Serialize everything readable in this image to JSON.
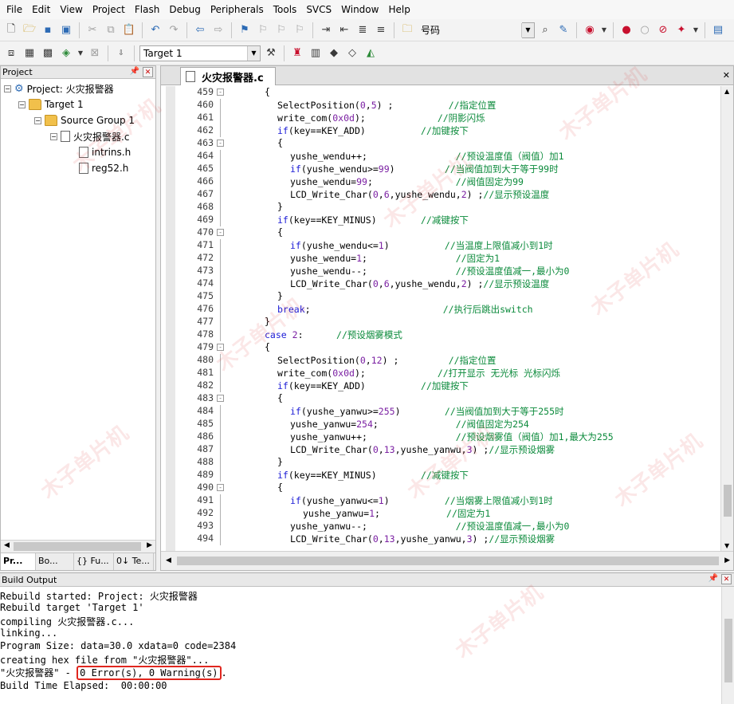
{
  "menu": [
    "File",
    "Edit",
    "View",
    "Project",
    "Flash",
    "Debug",
    "Peripherals",
    "Tools",
    "SVCS",
    "Window",
    "Help"
  ],
  "toolbar": {
    "find_text": "号码",
    "target_select": "Target 1"
  },
  "project_panel": {
    "title": "Project",
    "tree": {
      "project": "Project: 火灾报警器",
      "target": "Target 1",
      "group": "Source Group 1",
      "file": "火灾报警器.c",
      "includes": [
        "intrins.h",
        "reg52.h"
      ]
    },
    "tabs": [
      "Pr...",
      "Bo...",
      "{} Fu...",
      "0↓ Te..."
    ]
  },
  "editor": {
    "tab_label": "火灾报警器.c",
    "lines": [
      {
        "n": "459",
        "fold": "-",
        "indent": 0,
        "parts": [
          [
            "t",
            "{"
          ]
        ]
      },
      {
        "n": "460",
        "fold": "",
        "indent": 1,
        "parts": [
          [
            "t",
            "SelectPosition("
          ],
          [
            "num",
            "0"
          ],
          [
            "t",
            ","
          ],
          [
            "num",
            "5"
          ],
          [
            "t",
            ") ;          "
          ],
          [
            "cm",
            "//指定位置"
          ]
        ]
      },
      {
        "n": "461",
        "fold": "",
        "indent": 1,
        "parts": [
          [
            "t",
            "write_com("
          ],
          [
            "num",
            "0x0d"
          ],
          [
            "t",
            ");             "
          ],
          [
            "cm",
            "//阴影闪烁"
          ]
        ]
      },
      {
        "n": "462",
        "fold": "",
        "indent": 1,
        "parts": [
          [
            "kw",
            "if"
          ],
          [
            "t",
            "(key==KEY_ADD)          "
          ],
          [
            "cm",
            "//加键按下"
          ]
        ]
      },
      {
        "n": "463",
        "fold": "-",
        "indent": 1,
        "parts": [
          [
            "t",
            "{"
          ]
        ]
      },
      {
        "n": "464",
        "fold": "",
        "indent": 2,
        "parts": [
          [
            "t",
            "yushe_wendu++;                "
          ],
          [
            "cm",
            "//预设温度值（阀值）加1"
          ]
        ]
      },
      {
        "n": "465",
        "fold": "",
        "indent": 2,
        "parts": [
          [
            "kw",
            "if"
          ],
          [
            "t",
            "(yushe_wendu>="
          ],
          [
            "num",
            "99"
          ],
          [
            "t",
            ")         "
          ],
          [
            "cm",
            "//当阀值加到大于等于99时"
          ]
        ]
      },
      {
        "n": "466",
        "fold": "",
        "indent": 2,
        "parts": [
          [
            "t",
            "yushe_wendu="
          ],
          [
            "num",
            "99"
          ],
          [
            "t",
            ";               "
          ],
          [
            "cm",
            "//阀值固定为99"
          ]
        ]
      },
      {
        "n": "467",
        "fold": "",
        "indent": 2,
        "parts": [
          [
            "t",
            "LCD_Write_Char("
          ],
          [
            "num",
            "0"
          ],
          [
            "t",
            ","
          ],
          [
            "num",
            "6"
          ],
          [
            "t",
            ",yushe_wendu,"
          ],
          [
            "num",
            "2"
          ],
          [
            "t",
            ") ;"
          ],
          [
            "cm",
            "//显示预设温度"
          ]
        ]
      },
      {
        "n": "468",
        "fold": "",
        "indent": 1,
        "parts": [
          [
            "t",
            "}"
          ]
        ]
      },
      {
        "n": "469",
        "fold": "",
        "indent": 1,
        "parts": [
          [
            "kw",
            "if"
          ],
          [
            "t",
            "(key==KEY_MINUS)        "
          ],
          [
            "cm",
            "//减键按下"
          ]
        ]
      },
      {
        "n": "470",
        "fold": "-",
        "indent": 1,
        "parts": [
          [
            "t",
            "{"
          ]
        ]
      },
      {
        "n": "471",
        "fold": "",
        "indent": 2,
        "parts": [
          [
            "kw",
            "if"
          ],
          [
            "t",
            "(yushe_wendu<="
          ],
          [
            "num",
            "1"
          ],
          [
            "t",
            ")          "
          ],
          [
            "cm",
            "//当温度上限值减小到1时"
          ]
        ]
      },
      {
        "n": "472",
        "fold": "",
        "indent": 2,
        "parts": [
          [
            "t",
            "yushe_wendu="
          ],
          [
            "num",
            "1"
          ],
          [
            "t",
            ";                "
          ],
          [
            "cm",
            "//固定为1"
          ]
        ]
      },
      {
        "n": "473",
        "fold": "",
        "indent": 2,
        "parts": [
          [
            "t",
            "yushe_wendu--;                "
          ],
          [
            "cm",
            "//预设温度值减一,最小为0"
          ]
        ]
      },
      {
        "n": "474",
        "fold": "",
        "indent": 2,
        "parts": [
          [
            "t",
            "LCD_Write_Char("
          ],
          [
            "num",
            "0"
          ],
          [
            "t",
            ","
          ],
          [
            "num",
            "6"
          ],
          [
            "t",
            ",yushe_wendu,"
          ],
          [
            "num",
            "2"
          ],
          [
            "t",
            ") ;"
          ],
          [
            "cm",
            "//显示预设温度"
          ]
        ]
      },
      {
        "n": "475",
        "fold": "",
        "indent": 1,
        "parts": [
          [
            "t",
            "}"
          ]
        ]
      },
      {
        "n": "476",
        "fold": "",
        "indent": 1,
        "parts": [
          [
            "kw",
            "break"
          ],
          [
            "t",
            ";                        "
          ],
          [
            "cm",
            "//执行后跳出switch"
          ]
        ]
      },
      {
        "n": "477",
        "fold": "",
        "indent": 0,
        "parts": [
          [
            "t",
            "}"
          ]
        ]
      },
      {
        "n": "478",
        "fold": "",
        "indent": 0,
        "parts": [
          [
            "kw",
            "case"
          ],
          [
            "t",
            " "
          ],
          [
            "num",
            "2"
          ],
          [
            "t",
            ":      "
          ],
          [
            "cm",
            "//预设烟雾模式"
          ]
        ]
      },
      {
        "n": "479",
        "fold": "-",
        "indent": 0,
        "parts": [
          [
            "t",
            "{"
          ]
        ]
      },
      {
        "n": "480",
        "fold": "",
        "indent": 1,
        "parts": [
          [
            "t",
            "SelectPosition("
          ],
          [
            "num",
            "0"
          ],
          [
            "t",
            ","
          ],
          [
            "num",
            "12"
          ],
          [
            "t",
            ") ;         "
          ],
          [
            "cm",
            "//指定位置"
          ]
        ]
      },
      {
        "n": "481",
        "fold": "",
        "indent": 1,
        "parts": [
          [
            "t",
            "write_com("
          ],
          [
            "num",
            "0x0d"
          ],
          [
            "t",
            ");             "
          ],
          [
            "cm",
            "//打开显示 无光标 光标闪烁"
          ]
        ]
      },
      {
        "n": "482",
        "fold": "",
        "indent": 1,
        "parts": [
          [
            "kw",
            "if"
          ],
          [
            "t",
            "(key==KEY_ADD)          "
          ],
          [
            "cm",
            "//加键按下"
          ]
        ]
      },
      {
        "n": "483",
        "fold": "-",
        "indent": 1,
        "parts": [
          [
            "t",
            "{"
          ]
        ]
      },
      {
        "n": "484",
        "fold": "",
        "indent": 2,
        "parts": [
          [
            "kw",
            "if"
          ],
          [
            "t",
            "(yushe_yanwu>="
          ],
          [
            "num",
            "255"
          ],
          [
            "t",
            ")        "
          ],
          [
            "cm",
            "//当阀值加到大于等于255时"
          ]
        ]
      },
      {
        "n": "485",
        "fold": "",
        "indent": 2,
        "parts": [
          [
            "t",
            "yushe_yanwu="
          ],
          [
            "num",
            "254"
          ],
          [
            "t",
            ";              "
          ],
          [
            "cm",
            "//阀值固定为254"
          ]
        ]
      },
      {
        "n": "486",
        "fold": "",
        "indent": 2,
        "parts": [
          [
            "t",
            "yushe_yanwu++;                "
          ],
          [
            "cm",
            "//预设烟雾值（阀值）加1,最大为255"
          ]
        ]
      },
      {
        "n": "487",
        "fold": "",
        "indent": 2,
        "parts": [
          [
            "t",
            "LCD_Write_Char("
          ],
          [
            "num",
            "0"
          ],
          [
            "t",
            ","
          ],
          [
            "num",
            "13"
          ],
          [
            "t",
            ",yushe_yanwu,"
          ],
          [
            "num",
            "3"
          ],
          [
            "t",
            ") ;"
          ],
          [
            "cm",
            "//显示预设烟雾"
          ]
        ]
      },
      {
        "n": "488",
        "fold": "",
        "indent": 1,
        "parts": [
          [
            "t",
            "}"
          ]
        ]
      },
      {
        "n": "489",
        "fold": "",
        "indent": 1,
        "parts": [
          [
            "kw",
            "if"
          ],
          [
            "t",
            "(key==KEY_MINUS)        "
          ],
          [
            "cm",
            "//减键按下"
          ]
        ]
      },
      {
        "n": "490",
        "fold": "-",
        "indent": 1,
        "parts": [
          [
            "t",
            "{"
          ]
        ]
      },
      {
        "n": "491",
        "fold": "",
        "indent": 2,
        "parts": [
          [
            "kw",
            "if"
          ],
          [
            "t",
            "(yushe_yanwu<="
          ],
          [
            "num",
            "1"
          ],
          [
            "t",
            ")          "
          ],
          [
            "cm",
            "//当烟雾上限值减小到1时"
          ]
        ]
      },
      {
        "n": "492",
        "fold": "",
        "indent": 3,
        "parts": [
          [
            "t",
            "yushe_yanwu="
          ],
          [
            "num",
            "1"
          ],
          [
            "t",
            ";            "
          ],
          [
            "cm",
            "//固定为1"
          ]
        ]
      },
      {
        "n": "493",
        "fold": "",
        "indent": 2,
        "parts": [
          [
            "t",
            "yushe_yanwu--;                "
          ],
          [
            "cm",
            "//预设温度值减一,最小为0"
          ]
        ]
      },
      {
        "n": "494",
        "fold": "",
        "indent": 2,
        "parts": [
          [
            "t",
            "LCD_Write_Char("
          ],
          [
            "num",
            "0"
          ],
          [
            "t",
            ","
          ],
          [
            "num",
            "13"
          ],
          [
            "t",
            ",yushe_yanwu,"
          ],
          [
            "num",
            "3"
          ],
          [
            "t",
            ") ;"
          ],
          [
            "cm",
            "//显示预设烟雾"
          ]
        ]
      }
    ]
  },
  "build_output": {
    "title": "Build Output",
    "lines": [
      "Rebuild started: Project: 火灾报警器",
      "Rebuild target 'Target 1'",
      "compiling 火灾报警器.c...",
      "linking...",
      "Program Size: data=30.0 xdata=0 code=2384",
      "creating hex file from \"火灾报警器\"..."
    ],
    "result_prefix": "\"火灾报警器\" - ",
    "result_highlight": "0 Error(s), 0 Warning(s)",
    "result_suffix": ".",
    "elapsed": "Build Time Elapsed:  00:00:00"
  },
  "watermark": "木子单片机"
}
